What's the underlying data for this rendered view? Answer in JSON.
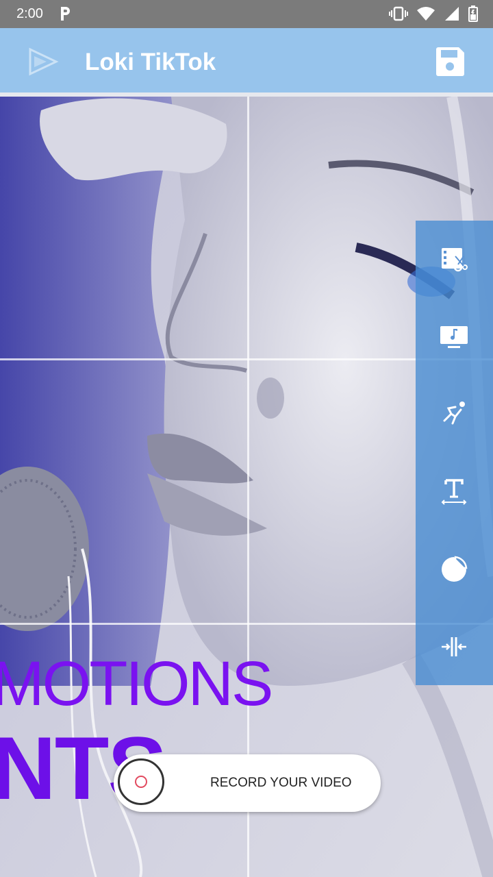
{
  "status_bar": {
    "time": "2:00",
    "icons": [
      "parking-icon",
      "vibrate-icon",
      "wifi-icon",
      "signal-icon",
      "battery-icon"
    ]
  },
  "app_bar": {
    "title": "Loki TikTok",
    "logo_icon": "app-logo-icon",
    "save_icon": "save-icon"
  },
  "canvas": {
    "overlay_line1": "MOTIONS",
    "overlay_line2": "NTS",
    "overlay_color": "#7a12f0"
  },
  "tools": [
    {
      "name": "trim-video-icon"
    },
    {
      "name": "music-icon"
    },
    {
      "name": "speed-icon"
    },
    {
      "name": "text-icon"
    },
    {
      "name": "sticker-icon"
    },
    {
      "name": "split-icon"
    }
  ],
  "record": {
    "label": "RECORD YOUR VIDEO"
  },
  "colors": {
    "app_bar": "#97c4ec",
    "status_bar": "#7b7b7b",
    "toolbar": "#468cd2",
    "record_dot": "#e24a5f"
  }
}
